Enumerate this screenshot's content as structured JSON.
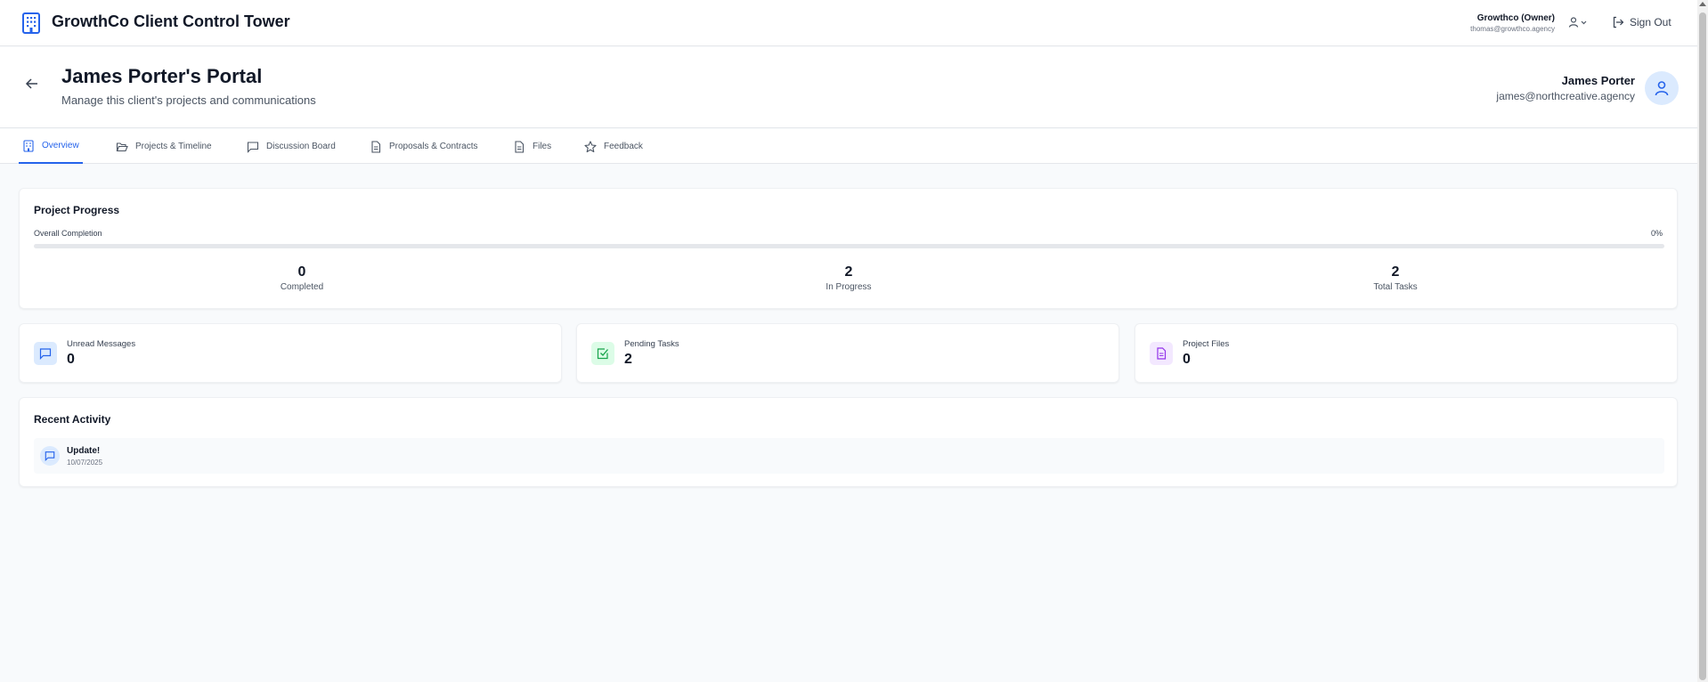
{
  "app": {
    "title": "GrowthCo Client Control Tower"
  },
  "account": {
    "name": "Growthco (Owner)",
    "email": "thomas@growthco.agency",
    "sign_out_label": "Sign Out"
  },
  "client": {
    "title": "James Porter's Portal",
    "subtitle": "Manage this client's projects and communications",
    "name": "James Porter",
    "email": "james@northcreative.agency"
  },
  "tabs": [
    {
      "label": "Overview",
      "icon": "building-icon",
      "active": true
    },
    {
      "label": "Projects & Timeline",
      "icon": "folder-open-icon",
      "active": false
    },
    {
      "label": "Discussion Board",
      "icon": "message-square-icon",
      "active": false
    },
    {
      "label": "Proposals & Contracts",
      "icon": "file-text-icon",
      "active": false
    },
    {
      "label": "Files",
      "icon": "file-icon",
      "active": false
    },
    {
      "label": "Feedback",
      "icon": "star-icon",
      "active": false
    }
  ],
  "progress": {
    "title": "Project Progress",
    "overall_label": "Overall Completion",
    "overall_percent_text": "0%",
    "overall_fraction": 0,
    "stats": [
      {
        "value": "0",
        "label": "Completed"
      },
      {
        "value": "2",
        "label": "In Progress"
      },
      {
        "value": "2",
        "label": "Total Tasks"
      }
    ]
  },
  "summary": [
    {
      "label": "Unread Messages",
      "value": "0",
      "icon": "message-square-icon",
      "color": "#2563eb",
      "bg": "#dbeafe"
    },
    {
      "label": "Pending Tasks",
      "value": "2",
      "icon": "check-square-icon",
      "color": "#16a34a",
      "bg": "#dcfce7"
    },
    {
      "label": "Project Files",
      "value": "0",
      "icon": "file-text-icon",
      "color": "#9333ea",
      "bg": "#f3e8ff"
    }
  ],
  "activity": {
    "title": "Recent Activity",
    "items": [
      {
        "title": "Update!",
        "date": "10/07/2025",
        "icon": "message-square-icon"
      }
    ]
  },
  "colors": {
    "accent": "#2563eb",
    "text": "#111827",
    "muted": "#4b5563",
    "background": "#f8fafc"
  }
}
